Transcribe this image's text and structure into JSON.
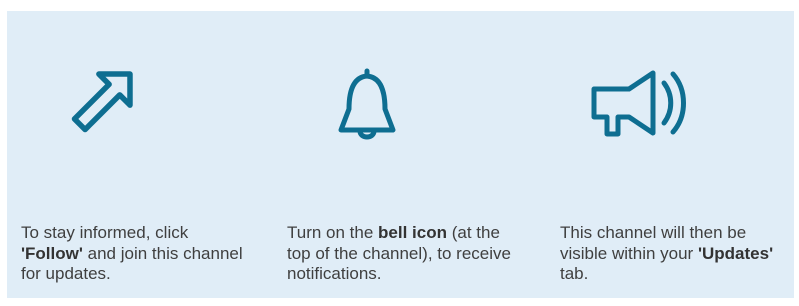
{
  "colors": {
    "background": "#e0edf7",
    "icon_stroke": "#0e6e91",
    "text": "#3f3f3f"
  },
  "steps": [
    {
      "icon": "arrow-up-right-icon",
      "text_before": "To stay informed, click ",
      "text_bold": "'Follow'",
      "text_after": " and join this channel for updates."
    },
    {
      "icon": "bell-icon",
      "text_before": "Turn on the ",
      "text_bold": "bell icon",
      "text_after": " (at the top of the channel), to receive notifications."
    },
    {
      "icon": "megaphone-icon",
      "text_before": "This channel will then be visible within your ",
      "text_bold": "'Updates'",
      "text_after": " tab."
    }
  ]
}
